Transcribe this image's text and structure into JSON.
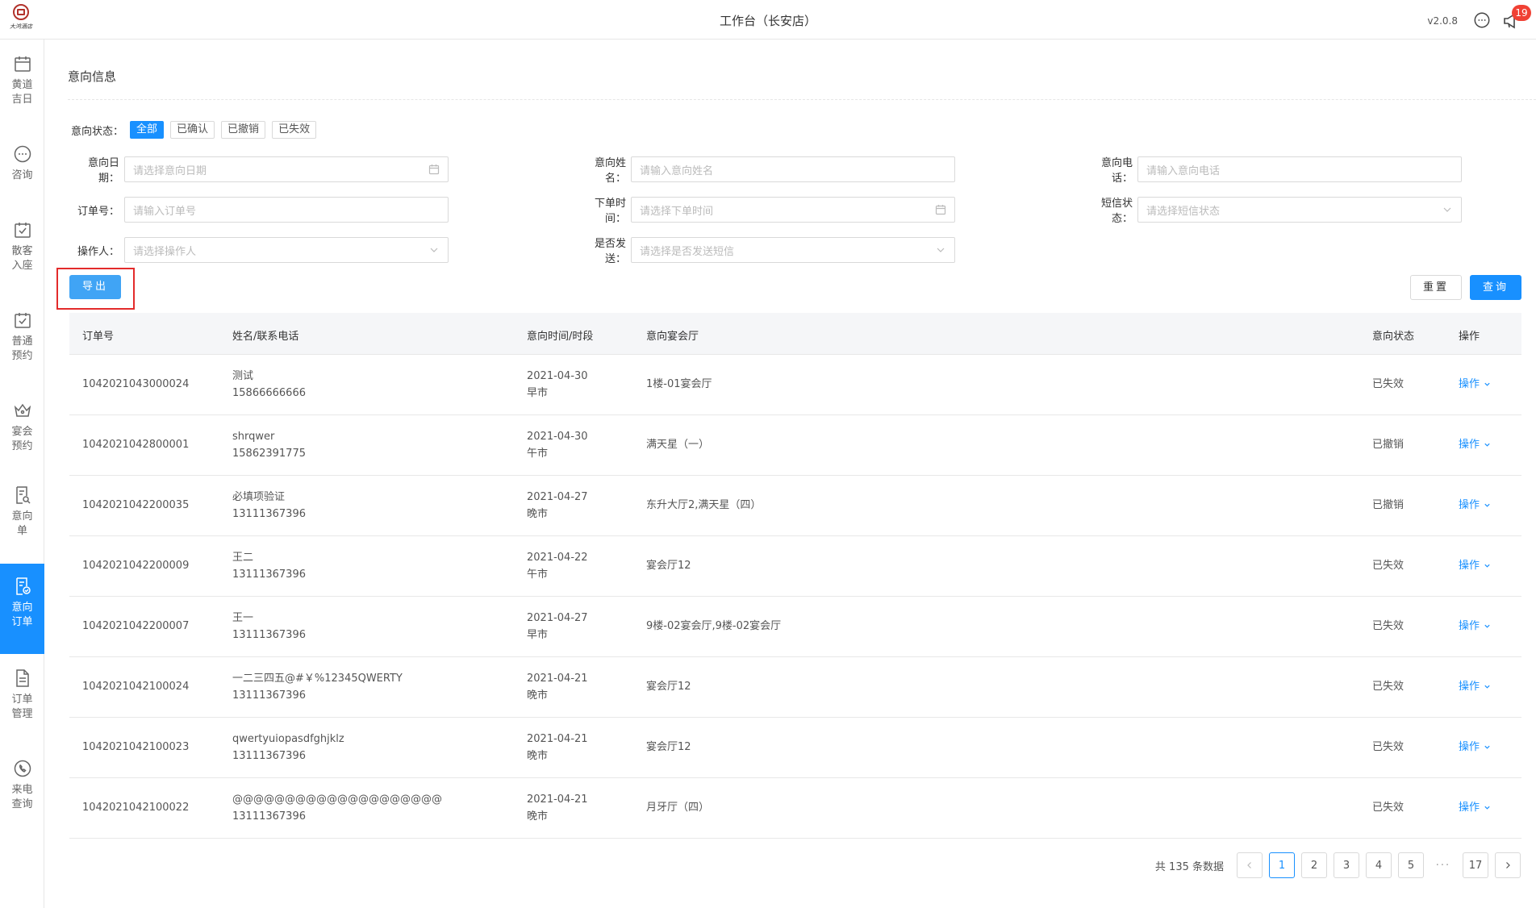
{
  "header": {
    "logo_text": "大鸿酒店",
    "title": "工作台（长安店）",
    "version": "v2.0.8",
    "notification_count": "19"
  },
  "sidebar": {
    "items": [
      {
        "label": "黄道吉日",
        "icon": "calendar-icon",
        "active": false
      },
      {
        "label": "咨询",
        "icon": "chat-icon",
        "active": false
      },
      {
        "label": "散客入座",
        "icon": "calendar-check-icon",
        "active": false
      },
      {
        "label": "普通预约",
        "icon": "calendar-check-icon",
        "active": false
      },
      {
        "label": "宴会预约",
        "icon": "crown-icon",
        "active": false
      },
      {
        "label": "意向单",
        "icon": "document-search-icon",
        "active": false
      },
      {
        "label": "意向订单",
        "icon": "document-badge-icon",
        "active": true
      },
      {
        "label": "订单管理",
        "icon": "document-icon",
        "active": false
      },
      {
        "label": "来电查询",
        "icon": "phone-icon",
        "active": false
      }
    ]
  },
  "page": {
    "title": "意向信息"
  },
  "filters": {
    "status_label": "意向状态：",
    "status_options": [
      "全部",
      "已确认",
      "已撤销",
      "已失效"
    ],
    "status_selected": 0,
    "intent_date": {
      "label": "意向日期：",
      "placeholder": "请选择意向日期"
    },
    "intent_name": {
      "label": "意向姓名：",
      "placeholder": "请输入意向姓名"
    },
    "intent_phone": {
      "label": "意向电话：",
      "placeholder": "请输入意向电话"
    },
    "order_no": {
      "label": "订单号：",
      "placeholder": "请输入订单号"
    },
    "order_time": {
      "label": "下单时间：",
      "placeholder": "请选择下单时间"
    },
    "sms_status": {
      "label": "短信状态：",
      "placeholder": "请选择短信状态"
    },
    "operator": {
      "label": "操作人：",
      "placeholder": "请选择操作人"
    },
    "sms_sent": {
      "label": "是否发送：",
      "placeholder": "请选择是否发送短信"
    }
  },
  "actions": {
    "export": "导出",
    "reset": "重置",
    "query": "查询"
  },
  "table": {
    "columns": [
      "订单号",
      "姓名/联系电话",
      "意向时间/时段",
      "意向宴会厅",
      "意向状态",
      "操作"
    ],
    "rows": [
      {
        "order_no": "1042021043000024",
        "name": "测试",
        "phone": "15866666666",
        "date": "2021-04-30",
        "period": "早市",
        "hall": "1楼-01宴会厅",
        "status": "已失效",
        "op": "操作"
      },
      {
        "order_no": "1042021042800001",
        "name": "shrqwer",
        "phone": "15862391775",
        "date": "2021-04-30",
        "period": "午市",
        "hall": "满天星（一）",
        "status": "已撤销",
        "op": "操作"
      },
      {
        "order_no": "1042021042200035",
        "name": "必填项验证",
        "phone": "13111367396",
        "date": "2021-04-27",
        "period": "晚市",
        "hall": "东升大厅2,满天星（四）",
        "status": "已撤销",
        "op": "操作"
      },
      {
        "order_no": "1042021042200009",
        "name": "王二",
        "phone": "13111367396",
        "date": "2021-04-22",
        "period": "午市",
        "hall": "宴会厅12",
        "status": "已失效",
        "op": "操作"
      },
      {
        "order_no": "1042021042200007",
        "name": "王一",
        "phone": "13111367396",
        "date": "2021-04-27",
        "period": "早市",
        "hall": "9楼-02宴会厅,9楼-02宴会厅",
        "status": "已失效",
        "op": "操作"
      },
      {
        "order_no": "1042021042100024",
        "name": "一二三四五@#￥%12345QWERTY",
        "phone": "13111367396",
        "date": "2021-04-21",
        "period": "晚市",
        "hall": "宴会厅12",
        "status": "已失效",
        "op": "操作"
      },
      {
        "order_no": "1042021042100023",
        "name": "qwertyuiopasdfghjklz",
        "phone": "13111367396",
        "date": "2021-04-21",
        "period": "晚市",
        "hall": "宴会厅12",
        "status": "已失效",
        "op": "操作"
      },
      {
        "order_no": "1042021042100022",
        "name": "@@@@@@@@@@@@@@@@@@@@",
        "phone": "13111367396",
        "date": "2021-04-21",
        "period": "晚市",
        "hall": "月牙厅（四）",
        "status": "已失效",
        "op": "操作"
      }
    ]
  },
  "pagination": {
    "total_text": "共 135 条数据",
    "pages": [
      "1",
      "2",
      "3",
      "4",
      "5",
      "···",
      "17"
    ],
    "current": "1"
  }
}
